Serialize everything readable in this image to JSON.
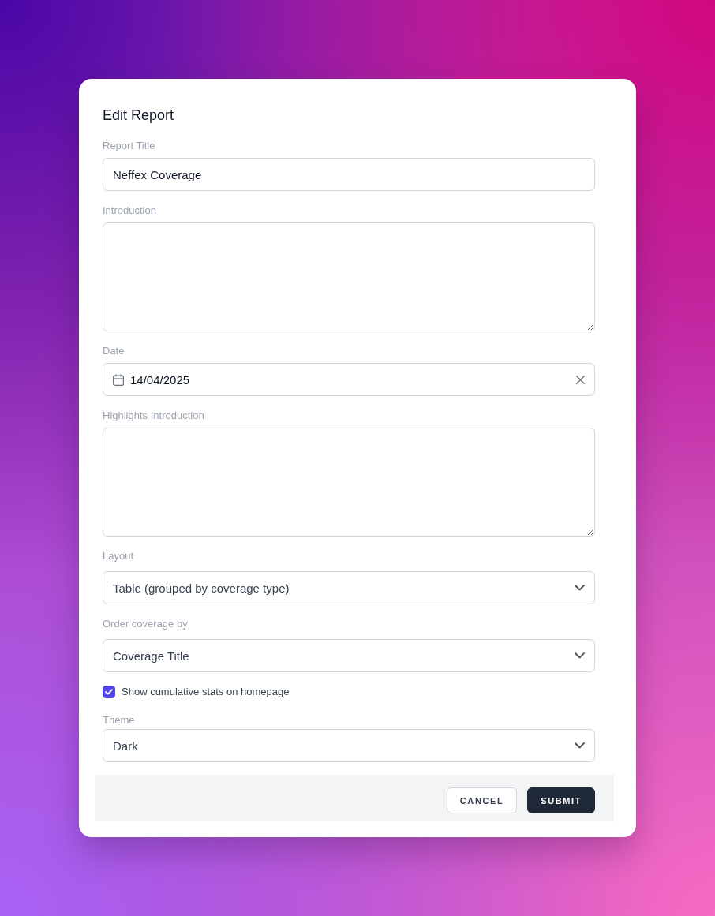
{
  "dialog": {
    "title": "Edit Report"
  },
  "fields": [
    {
      "kind": "text",
      "label": "Report Title",
      "value": "Neffex Coverage"
    },
    {
      "kind": "textarea",
      "label": "Introduction"
    },
    {
      "kind": "date",
      "label": "Date",
      "value": "14/04/2025"
    },
    {
      "kind": "textarea",
      "label": "Highlights Introduction"
    },
    {
      "kind": "select",
      "label": "Layout",
      "value": "Table (grouped by coverage type)"
    },
    {
      "kind": "select",
      "label": "Order coverage by",
      "value": "Coverage Title"
    },
    {
      "kind": "checkbox",
      "label": "Show cumulative stats on homepage",
      "checked": true
    },
    {
      "kind": "select",
      "label": "Theme",
      "value": "Dark"
    }
  ],
  "buttons": [
    {
      "kind": "secondary",
      "label": "CANCEL"
    },
    {
      "kind": "primary",
      "label": "SUBMIT"
    }
  ]
}
